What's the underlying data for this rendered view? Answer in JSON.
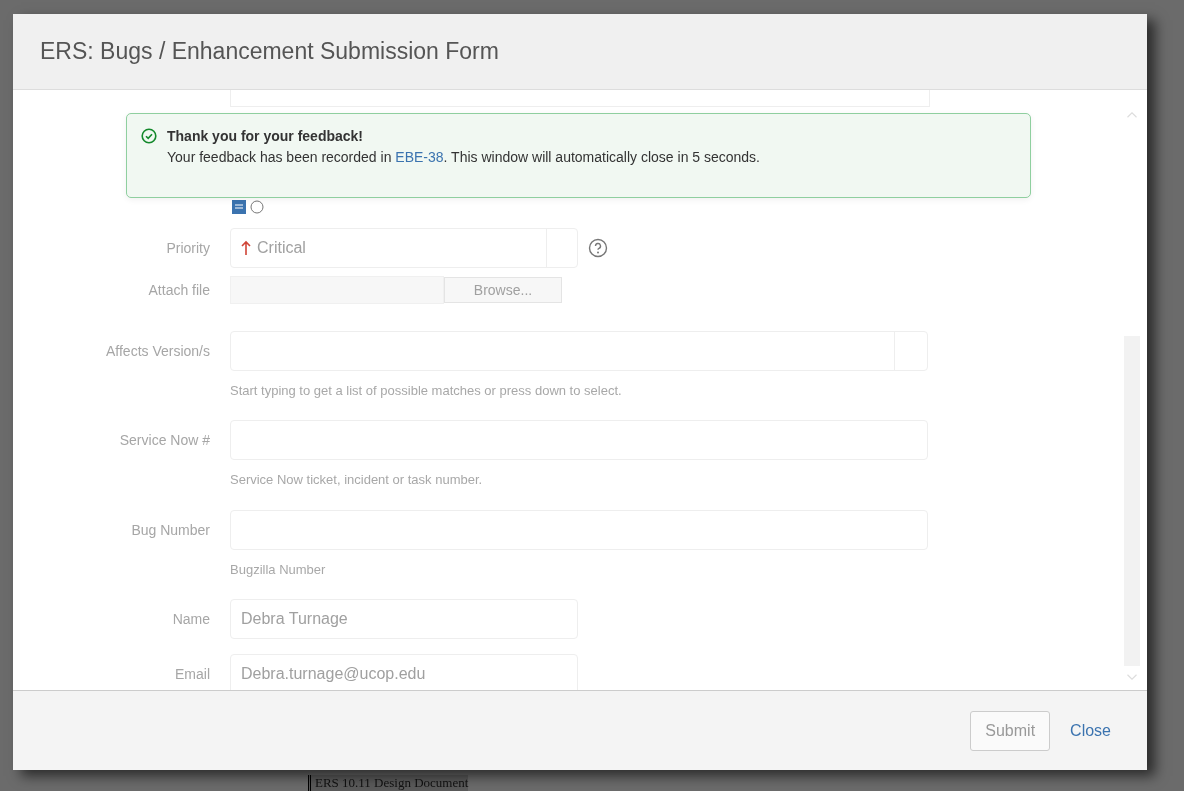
{
  "dialog": {
    "title": "ERS: Bugs / Enhancement Submission Form"
  },
  "alert": {
    "heading": "Thank you for your feedback!",
    "message_before": "Your feedback has been recorded in ",
    "link": "EBE-38",
    "message_after": ". This window will automatically close in 5 seconds."
  },
  "form": {
    "fields": [
      {
        "kind": "select",
        "label": "Priority",
        "value": "Critical"
      },
      {
        "kind": "file",
        "label": "Attach file",
        "button": "Browse..."
      },
      {
        "kind": "picker",
        "label": "Affects Version/s",
        "hint": "Start typing to get a list of possible matches or press down to select."
      },
      {
        "kind": "text",
        "label": "Service Now #",
        "hint": "Service Now ticket, incident or task number."
      },
      {
        "kind": "text",
        "label": "Bug Number",
        "hint": "Bugzilla Number"
      },
      {
        "kind": "short",
        "label": "Name",
        "value": "Debra Turnage"
      },
      {
        "kind": "short",
        "label": "Email",
        "value": "Debra.turnage@ucop.edu"
      }
    ]
  },
  "footer": {
    "submit": "Submit",
    "close": "Close"
  },
  "background_page": {
    "text": "ERS 10.11 Design Document"
  }
}
